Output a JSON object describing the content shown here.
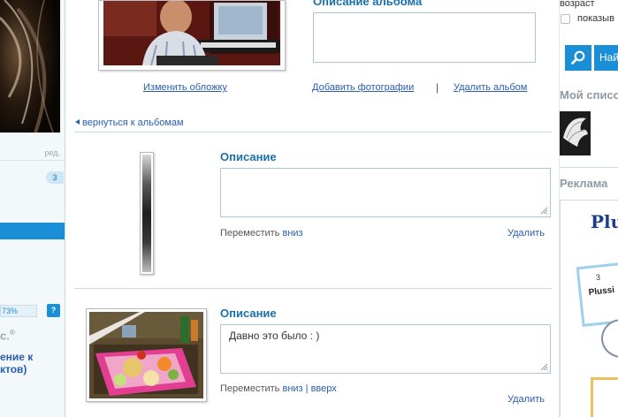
{
  "left": {
    "edit_label": "ред.",
    "badge_count": "3",
    "progress_text": "73%",
    "progress_value": 0.73,
    "help_label": "?",
    "brand_text": "с.",
    "brand_mark": "®",
    "promo_line1": "ение к",
    "promo_line2": "ктов)"
  },
  "album": {
    "description_title": "Описание альбома",
    "description_value": "",
    "change_cover_label": "Изменить обложку",
    "add_photos_label": "Добавить фотографии",
    "separator": "|",
    "delete_album_label": "Удалить альбом",
    "back_label": "вернуться к альбомам"
  },
  "photos": [
    {
      "title": "Описание",
      "description": "",
      "move_label": "Переместить",
      "move_down": "вниз",
      "delete_label": "Удалить"
    },
    {
      "title": "Описание",
      "description": "Давно это было : )",
      "move_label": "Переместить",
      "move_down": "вниз",
      "move_sep": "|",
      "move_up": "вверх",
      "delete_label": "Удалить"
    }
  ],
  "right": {
    "age_label": "возраст",
    "show_label": "показыв",
    "show_checked": false,
    "search_icon": "magnifier-icon",
    "find_label": "Най",
    "my_list_title": "Мой списо",
    "ads_title": "Реклама",
    "ad_logo_text": "Plu",
    "ad_small_text": "Plussi",
    "ad_small_mark": "3"
  },
  "colors": {
    "accent": "#1a8ed6",
    "title_blue": "#1a6fa8",
    "link_blue": "#2a5db0",
    "border_blue": "#a9c7d8",
    "muted_heading": "#8f9aa1"
  }
}
